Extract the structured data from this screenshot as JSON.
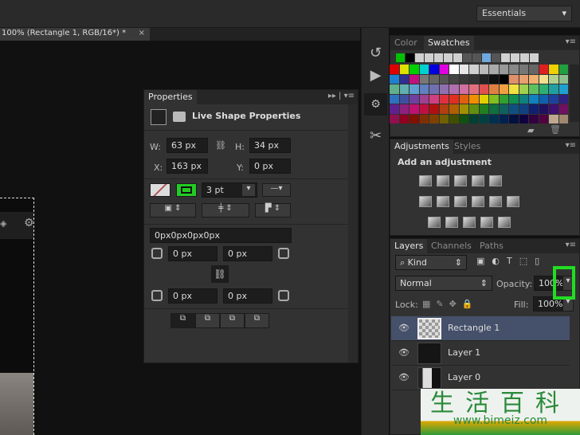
{
  "topbar": {
    "workspace": "Essentials"
  },
  "document": {
    "tab_title": "100% (Rectangle 1, RGB/16*) *",
    "close": "×"
  },
  "properties": {
    "title": "Properties",
    "heading": "Live Shape Properties",
    "w_label": "W:",
    "w": "63 px",
    "h_label": "H:",
    "h": "34 px",
    "x_label": "X:",
    "x": "163 px",
    "y_label": "Y:",
    "y": "0 px",
    "stroke_width": "3 pt",
    "stroke_color": "#22cc22",
    "corners": "0px0px0px0px",
    "corner_tl": "0 px",
    "corner_tr": "0 px",
    "corner_bl": "0 px",
    "corner_br": "0 px"
  },
  "swatches": {
    "tabs": [
      "Color",
      "Swatches"
    ],
    "recent": [
      "#00c000",
      "#000000",
      "#d0d0d0",
      "#d0d0d0",
      "#d0d0d0",
      "#d0d0d0",
      "#d0d0d0",
      "#555555",
      "#555555",
      "#6fa8dc",
      "#555555",
      "#d0d0d0",
      "#d0d0d0",
      "#d0d0d0",
      "#d0d0d0"
    ],
    "grid": [
      "#e00000",
      "#e0e000",
      "#00d000",
      "#00d0d0",
      "#0000e0",
      "#e000e0",
      "#ffffff",
      "#e8e8e8",
      "#d0d0d0",
      "#bbbbbb",
      "#aaaaaa",
      "#999999",
      "#888888",
      "#777777",
      "#666666",
      "#e02020",
      "#f0d000",
      "#20a040",
      "#2080d0",
      "#303090",
      "#c01080",
      "#777777",
      "#666666",
      "#555555",
      "#444444",
      "#3a3a3a",
      "#333333",
      "#222222",
      "#111111",
      "#000000",
      "#e0906a",
      "#e8a070",
      "#f0b070",
      "#f0e090",
      "#b0d090",
      "#90c090",
      "#60b090",
      "#60b0b0",
      "#60a0d0",
      "#6080c0",
      "#7070b0",
      "#9070b0",
      "#b070b0",
      "#d070a0",
      "#e07080",
      "#e05050",
      "#e08040",
      "#f0a040",
      "#f0e040",
      "#a0d050",
      "#60c060",
      "#30b070",
      "#20a0a0",
      "#20a0d0",
      "#3070c0",
      "#4050a0",
      "#7040a0",
      "#a04090",
      "#d04080",
      "#e03040",
      "#e03020",
      "#e06010",
      "#f09000",
      "#e0d000",
      "#80c020",
      "#30a030",
      "#109050",
      "#108080",
      "#1080c0",
      "#1060b0",
      "#2040a0",
      "#302080",
      "#602090",
      "#902080",
      "#c01070",
      "#c01040",
      "#b01010",
      "#b04010",
      "#b06000",
      "#a09000",
      "#609010",
      "#208020",
      "#107040",
      "#106060",
      "#105080",
      "#104080",
      "#102070",
      "#201060",
      "#401070",
      "#701060",
      "#901050",
      "#900020",
      "#801000",
      "#803000",
      "#804000",
      "#706000",
      "#405000",
      "#105010",
      "#004030",
      "#004040",
      "#003050",
      "#002050",
      "#001040",
      "#100040",
      "#300040",
      "#500040",
      "#c0a890",
      "#a08870"
    ]
  },
  "adjustments": {
    "tabs": [
      "Adjustments",
      "Styles"
    ],
    "heading": "Add an adjustment"
  },
  "layers": {
    "tabs": [
      "Layers",
      "Channels",
      "Paths"
    ],
    "filter": "Kind",
    "blend_mode": "Normal",
    "opacity_label": "Opacity:",
    "opacity": "100%",
    "lock_label": "Lock:",
    "fill_label": "Fill:",
    "fill": "100%",
    "items": [
      {
        "name": "Rectangle 1",
        "selected": true
      },
      {
        "name": "Layer 1"
      },
      {
        "name": "Layer 0"
      }
    ]
  },
  "highlight_color": "#22dd22",
  "watermark": {
    "chars": "生活百科",
    "url": "www.bimeiz.com"
  }
}
